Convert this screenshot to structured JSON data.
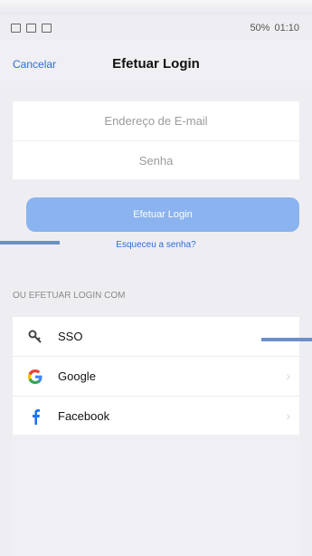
{
  "status_bar": {
    "info": "50%",
    "time": "01:10"
  },
  "header": {
    "cancel_label": "Cancelar",
    "title": "Efetuar Login"
  },
  "form": {
    "email_placeholder": "Endereço de E-mail",
    "password_placeholder": "Senha"
  },
  "actions": {
    "login_label": "Efetuar Login",
    "forgot_label": "Esqueceu a senha?"
  },
  "alt_login": {
    "section_label": "OU EFETUAR LOGIN COM",
    "items": [
      {
        "label": "SSO",
        "icon": "key-icon"
      },
      {
        "label": "Google",
        "icon": "google-icon"
      },
      {
        "label": "Facebook",
        "icon": "facebook-icon"
      }
    ]
  },
  "colors": {
    "accent": "#2b6fd6",
    "button": "#8ab3ef"
  }
}
